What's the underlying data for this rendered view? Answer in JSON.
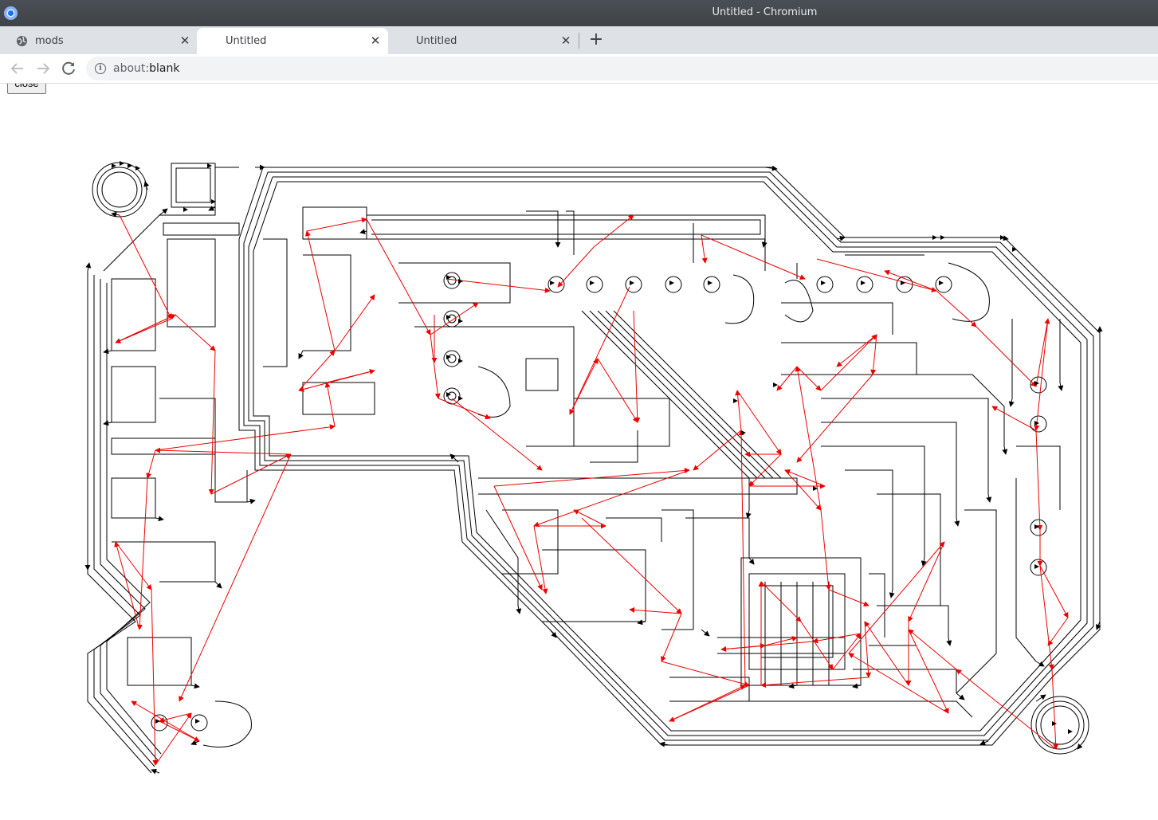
{
  "window": {
    "title": "Untitled - Chromium"
  },
  "tabs": [
    {
      "label": "mods",
      "active": false
    },
    {
      "label": "Untitled",
      "active": true
    },
    {
      "label": "Untitled",
      "active": false
    }
  ],
  "address_bar": {
    "scheme": "about:",
    "host": "blank"
  },
  "page": {
    "close_button_label": "close"
  },
  "colors": {
    "toolpath": "#000000",
    "rapid_move": "#ff0000",
    "titlebar": "#45494e",
    "tabstrip": "#dee1e6"
  },
  "icons": {
    "app": "chromium-icon",
    "tab_favicon": "globe-icon",
    "back": "back-arrow-icon",
    "forward": "forward-arrow-icon",
    "reload": "reload-icon",
    "info": "info-icon",
    "close_tab": "close-icon",
    "new_tab": "plus-icon"
  }
}
